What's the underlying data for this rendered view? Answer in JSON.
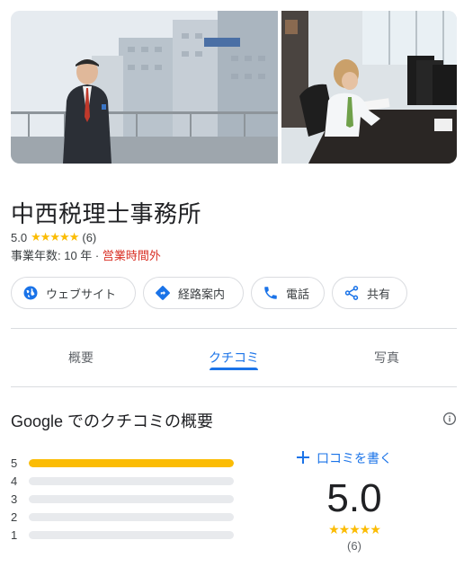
{
  "place": {
    "name": "中西税理士事務所",
    "rating": "5.0",
    "stars": "★★★★★",
    "review_count": "(6)",
    "years": "事業年数: 10 年 · ",
    "hours_status": "営業時間外"
  },
  "actions": [
    {
      "label": "ウェブサイト",
      "icon": "globe-icon"
    },
    {
      "label": "経路案内",
      "icon": "directions-icon"
    },
    {
      "label": "電話",
      "icon": "phone-icon"
    },
    {
      "label": "共有",
      "icon": "share-icon"
    }
  ],
  "tabs": [
    {
      "label": "概要",
      "active": false
    },
    {
      "label": "クチコミ",
      "active": true
    },
    {
      "label": "写真",
      "active": false
    }
  ],
  "reviews": {
    "title": "Google でのクチコミの概要",
    "write_review": "口コミを書く",
    "score": "5.0",
    "stars": "★★★★★",
    "count": "(6)",
    "distribution": [
      {
        "stars": "5",
        "fraction": 1.0
      },
      {
        "stars": "4",
        "fraction": 0
      },
      {
        "stars": "3",
        "fraction": 0
      },
      {
        "stars": "2",
        "fraction": 0
      },
      {
        "stars": "1",
        "fraction": 0
      }
    ]
  },
  "colors": {
    "accent": "#1a73e8",
    "star": "#fbbc04",
    "closed": "#d93025"
  }
}
